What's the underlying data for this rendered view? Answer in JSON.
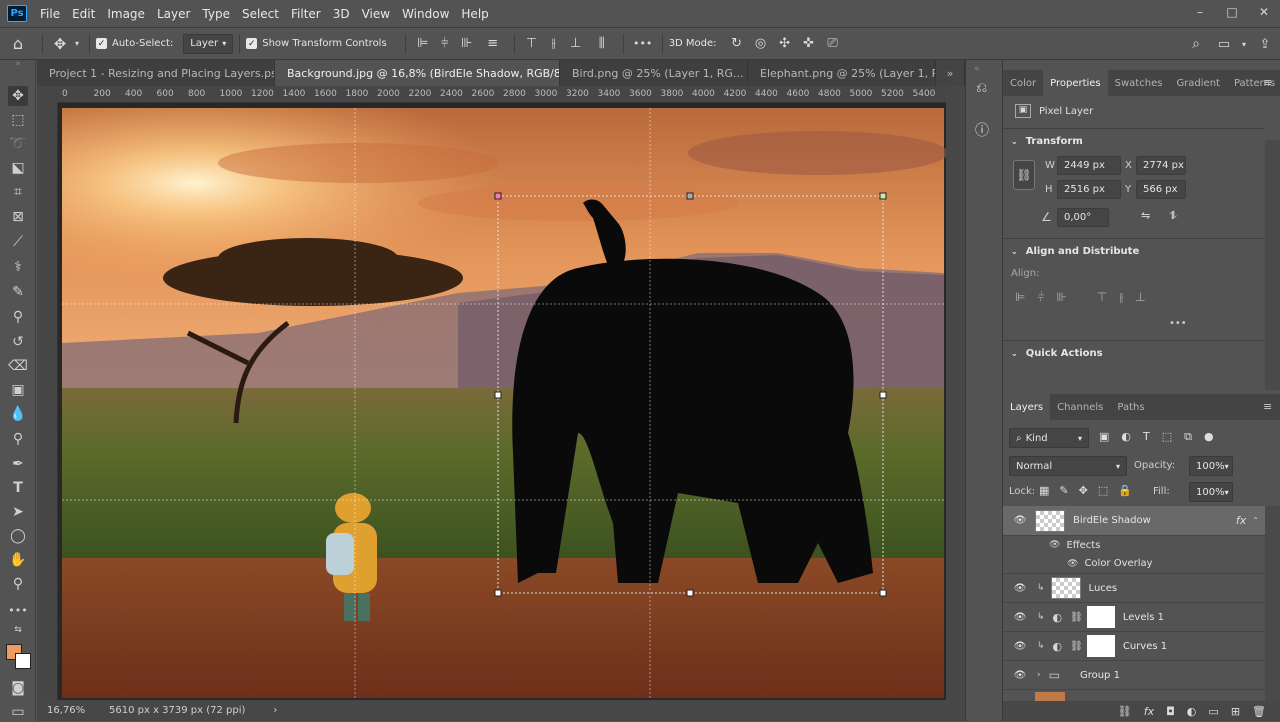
{
  "app": {
    "logo": "Ps"
  },
  "menu": [
    "File",
    "Edit",
    "Image",
    "Layer",
    "Type",
    "Select",
    "Filter",
    "3D",
    "View",
    "Window",
    "Help"
  ],
  "window_controls": {
    "minimize": "–",
    "restore": "□",
    "close": "✕"
  },
  "options_bar": {
    "auto_select_label": "Auto-Select:",
    "auto_select_target": "Layer",
    "show_transform_label": "Show Transform Controls",
    "more": "•••",
    "mode_label": "3D Mode:"
  },
  "tabs": [
    {
      "label": "Project 1 - Resizing and Placing Layers.psd",
      "active": false
    },
    {
      "label": "Background.jpg @ 16,8% (BirdEle Shadow, RGB/8) *",
      "active": true
    },
    {
      "label": "Bird.png @ 25% (Layer 1, RG...",
      "active": false
    },
    {
      "label": "Elephant.png @ 25% (Layer 1, RG...",
      "active": false
    }
  ],
  "ruler_ticks": [
    "0",
    "200",
    "400",
    "600",
    "800",
    "1000",
    "1200",
    "1400",
    "1600",
    "1800",
    "2000",
    "2200",
    "2400",
    "2600",
    "2800",
    "3000",
    "3200",
    "3400",
    "3600",
    "3800",
    "4000",
    "4200",
    "4400",
    "4600",
    "4800",
    "5000",
    "5200",
    "5400"
  ],
  "status": {
    "zoom": "16,76%",
    "doc_info": "5610 px x 3739 px (72 ppi)"
  },
  "colors": {
    "foreground": "#ef9a62",
    "background": "#ffffff",
    "accent": "#31a8ff"
  },
  "properties_panel": {
    "tabs": [
      "Color",
      "Properties",
      "Swatches",
      "Gradient",
      "Patterns"
    ],
    "active_tab": "Properties",
    "layer_kind": "Pixel Layer",
    "transform": {
      "title": "Transform",
      "w_label": "W",
      "w": "2449 px",
      "h_label": "H",
      "h": "2516 px",
      "x_label": "X",
      "x": "2774 px",
      "y_label": "Y",
      "y": "566 px",
      "angle": "0,00°"
    },
    "align": {
      "title": "Align and Distribute",
      "align_label": "Align:"
    },
    "quick_actions": {
      "title": "Quick Actions"
    }
  },
  "layers_panel": {
    "tabs": [
      "Layers",
      "Channels",
      "Paths"
    ],
    "active_tab": "Layers",
    "filter_kind": "Kind",
    "blend_mode": "Normal",
    "opacity_label": "Opacity:",
    "opacity": "100%",
    "lock_label": "Lock:",
    "fill_label": "Fill:",
    "fill": "100%",
    "layers": [
      {
        "name": "BirdEle Shadow",
        "fx": "fx",
        "selected": true
      },
      {
        "name": "Effects",
        "sub": true
      },
      {
        "name": "Color Overlay",
        "sub": true
      },
      {
        "name": "Luces"
      },
      {
        "name": "Levels 1"
      },
      {
        "name": "Curves 1"
      },
      {
        "name": "Group 1"
      }
    ]
  }
}
